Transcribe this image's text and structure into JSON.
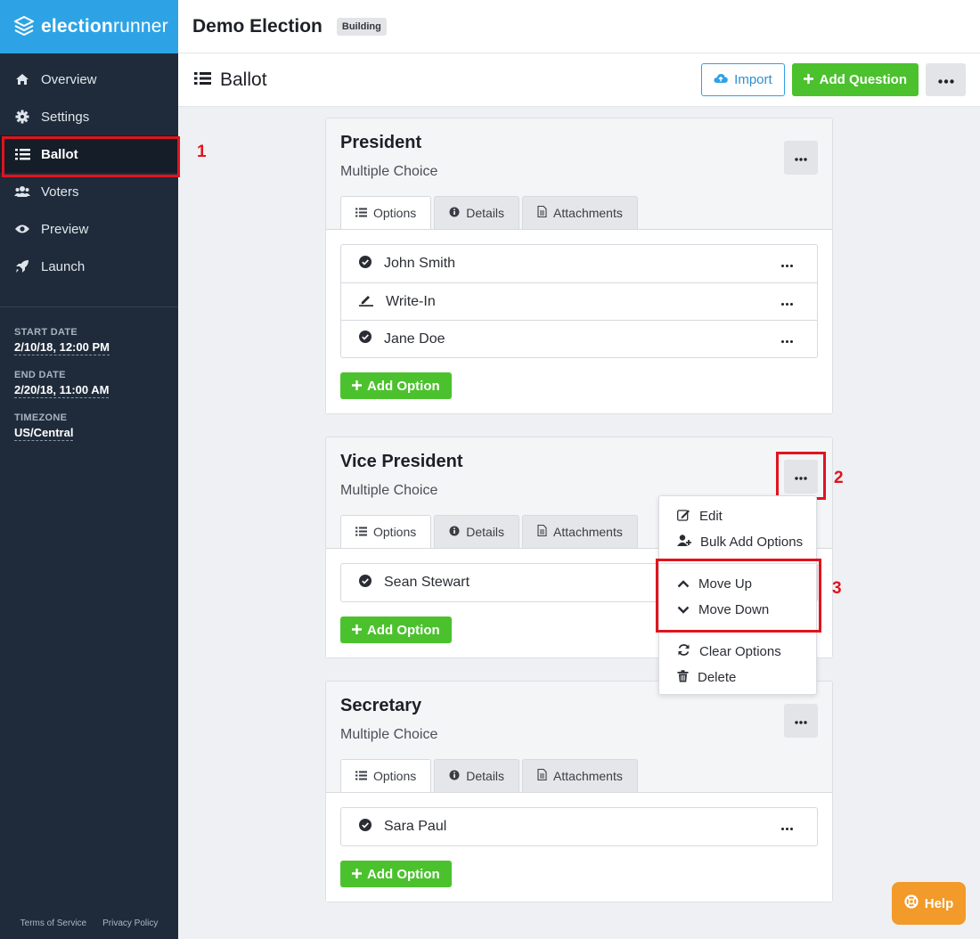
{
  "brand": {
    "logo_text": "electionrunner",
    "logo_bold": "election",
    "logo_light": "runner"
  },
  "header": {
    "election_title": "Demo Election",
    "status_badge": "Building"
  },
  "sidebar": {
    "items": [
      {
        "label": "Overview",
        "icon": "home-icon"
      },
      {
        "label": "Settings",
        "icon": "gear-icon"
      },
      {
        "label": "Ballot",
        "icon": "list-icon",
        "active": true
      },
      {
        "label": "Voters",
        "icon": "users-icon"
      },
      {
        "label": "Preview",
        "icon": "eye-icon"
      },
      {
        "label": "Launch",
        "icon": "rocket-icon"
      }
    ],
    "meta": [
      {
        "label": "START DATE",
        "value": "2/10/18, 12:00 PM"
      },
      {
        "label": "END DATE",
        "value": "2/20/18, 11:00 AM"
      },
      {
        "label": "TIMEZONE",
        "value": "US/Central"
      }
    ],
    "footer": {
      "terms": "Terms of Service",
      "privacy": "Privacy Policy"
    }
  },
  "page": {
    "title": "Ballot",
    "import_label": "Import",
    "add_question_label": "Add Question"
  },
  "tabs": {
    "options": "Options",
    "details": "Details",
    "attachments": "Attachments"
  },
  "add_option_label": "Add Option",
  "questions": [
    {
      "title": "President",
      "type": "Multiple Choice",
      "options": [
        {
          "label": "John Smith",
          "icon": "check-circle-icon"
        },
        {
          "label": "Write-In",
          "icon": "pen-icon"
        },
        {
          "label": "Jane Doe",
          "icon": "check-circle-icon"
        }
      ]
    },
    {
      "title": "Vice President",
      "type": "Multiple Choice",
      "options": [
        {
          "label": "Sean Stewart",
          "icon": "check-circle-icon"
        }
      ]
    },
    {
      "title": "Secretary",
      "type": "Multiple Choice",
      "options": [
        {
          "label": "Sara Paul",
          "icon": "check-circle-icon"
        }
      ]
    }
  ],
  "dropdown": {
    "edit": "Edit",
    "bulk_add": "Bulk Add Options",
    "move_up": "Move Up",
    "move_down": "Move Down",
    "clear": "Clear Options",
    "delete": "Delete"
  },
  "annotations": {
    "one": "1",
    "two": "2",
    "three": "3"
  },
  "help_label": "Help",
  "colors": {
    "sidebar_bg": "#1f2b3a",
    "brand_blue": "#2da3e6",
    "green": "#4cc12e",
    "orange": "#f29a2a",
    "annotation_red": "#e0141e"
  }
}
